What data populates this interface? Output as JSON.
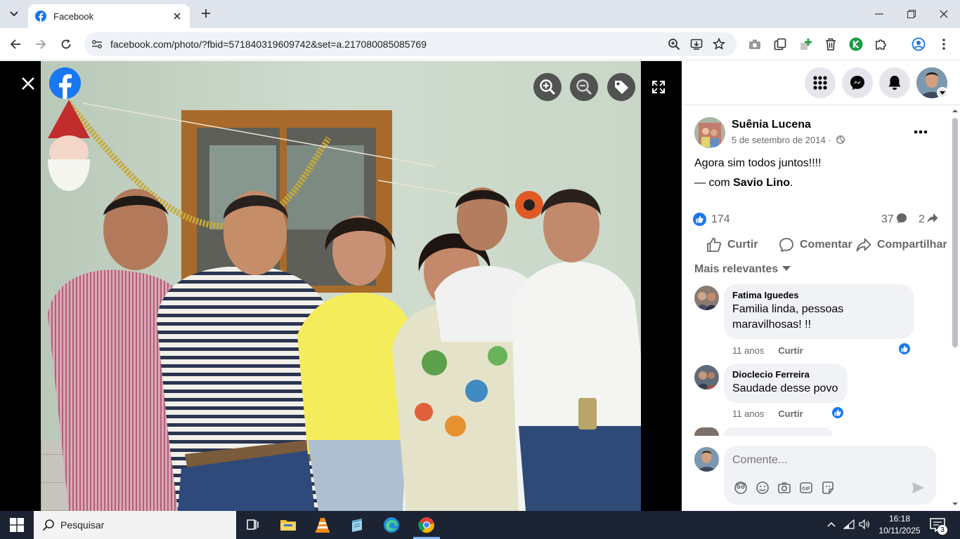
{
  "browser": {
    "tab_title": "Facebook",
    "url": "facebook.com/photo/?fbid=571840319609742&set=a.217080085085769"
  },
  "post": {
    "author": "Suênia Lucena",
    "date": "5 de setembro de 2014 · ",
    "caption": "Agora sim todos juntos!!!!",
    "with_prefix": "— com ",
    "with_name": "Savio Lino",
    "with_suffix": ".",
    "likes": "174",
    "comments": "37",
    "shares": "2",
    "actions": {
      "like": "Curtir",
      "comment": "Comentar",
      "share": "Compartilhar"
    },
    "sort_label": "Mais relevantes"
  },
  "comments": [
    {
      "name": "Fatima Iguedes",
      "text_line1": "Familia linda, pessoas",
      "text_line2": "maravilhosas! !!",
      "age": "11 anos",
      "like": "Curtir"
    },
    {
      "name": "Dioclecio Ferreira",
      "text_line1": "Saudade desse povo",
      "age": "11 anos",
      "like": "Curtir"
    }
  ],
  "compose": {
    "placeholder": "Comente..."
  },
  "taskbar": {
    "search_label": "Pesquisar",
    "time": "16:18",
    "date": "10/11/2025",
    "notifications": "3"
  },
  "colors": {
    "facebook_blue": "#1877f2",
    "taskbar_bg": "#1c2333",
    "tabstrip_bg": "#dfe3eb"
  }
}
